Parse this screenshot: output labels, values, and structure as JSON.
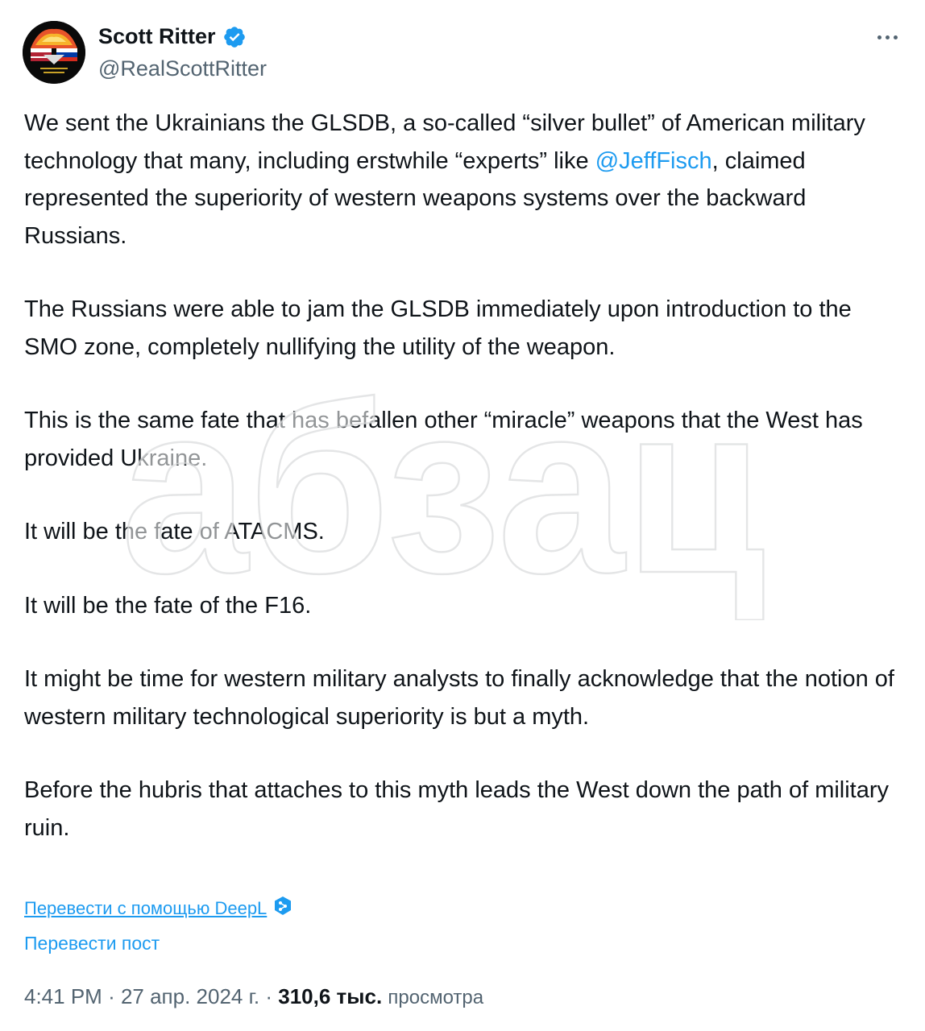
{
  "author": {
    "name": "Scott Ritter",
    "handle": "@RealScottRitter",
    "verified_icon": "verified-badge-icon"
  },
  "more_icon": "more-horizontal-icon",
  "tweet": {
    "p1_a": "We sent the Ukrainians the GLSDB, a so-called “silver bullet” of American military technology that many, including erstwhile “experts” like ",
    "mention": "@JeffFisch",
    "p1_b": ", claimed represented the superiority of western weapons systems over the backward Russians.",
    "p2": "The Russians were able to jam the GLSDB immediately upon introduction to the SMO zone, completely nullifying the utility of the weapon.",
    "p3": "This is the same fate that has befallen other “miracle” weapons that the West has provided Ukraine.",
    "p4": "It will be the fate of ATACMS.",
    "p5": "It will be the fate of the F16.",
    "p6": "It might be time for western military analysts to finally acknowledge that the notion of western military technological superiority is but a myth.",
    "p7": "Before the hubris that attaches to this myth leads the West down the path of military ruin."
  },
  "translate_deepl": "Перевести с помощью DeepL",
  "translate_post": "Перевести пост",
  "meta": {
    "time": "4:41 PM",
    "date": "27 апр. 2024 г.",
    "views_count": "310,6 тыс.",
    "views_label": "просмотра"
  },
  "watermark": "абзац",
  "colors": {
    "link": "#1d9bf0",
    "text": "#0f1419",
    "secondary": "#536471"
  }
}
